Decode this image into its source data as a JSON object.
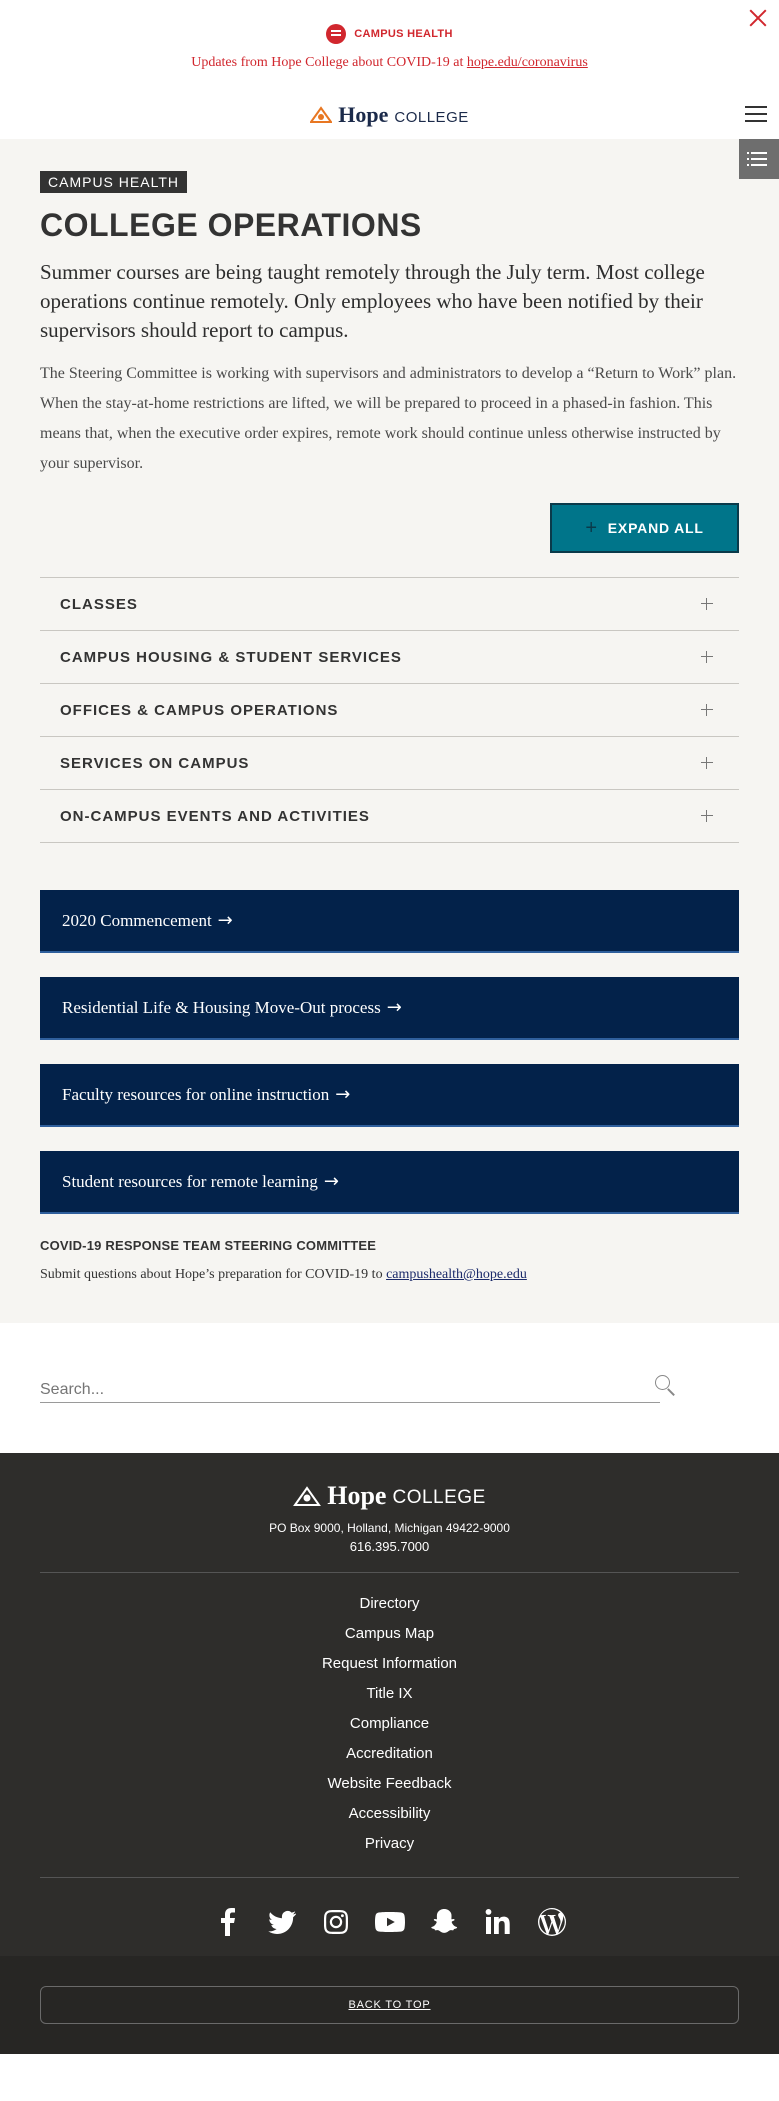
{
  "alert": {
    "tag": "CAMPUS HEALTH",
    "message_prefix": "Updates from Hope College about COVID-19 at ",
    "message_link": "hope.edu/coronavirus"
  },
  "header": {
    "logo_hope": "Hope",
    "logo_college": "COLLEGE"
  },
  "main": {
    "badge": "CAMPUS HEALTH",
    "title": "COLLEGE OPERATIONS",
    "lead": "Summer courses are being taught remotely through the July term. Most college operations continue remotely. Only employees who have been notified by their supervisors should report to campus.",
    "body": "The Steering Committee is working with supervisors and administrators to develop a “Return to Work” plan. When the stay-at-home restrictions are lifted, we will be prepared to proceed in a phased-in fashion. This means that, when the executive order expires, remote work should continue unless otherwise instructed by your supervisor.",
    "expand_all": "EXPAND ALL",
    "accordion": [
      {
        "label": "CLASSES"
      },
      {
        "label": "CAMPUS HOUSING & STUDENT SERVICES"
      },
      {
        "label": "OFFICES & CAMPUS OPERATIONS"
      },
      {
        "label": "SERVICES ON CAMPUS"
      },
      {
        "label": "ON-CAMPUS EVENTS AND ACTIVITIES"
      }
    ],
    "ctas": [
      {
        "label": "2020 Commencement"
      },
      {
        "label": "Residential Life & Housing Move-Out process"
      },
      {
        "label": "Faculty resources for online instruction"
      },
      {
        "label": "Student resources for remote learning"
      }
    ],
    "committee_title": "COVID-19 RESPONSE TEAM STEERING COMMITTEE",
    "committee_text": "Submit questions about Hope’s preparation for COVID-19 to ",
    "committee_email": "campushealth@hope.edu"
  },
  "search": {
    "placeholder": "Search..."
  },
  "footer": {
    "logo_hope": "Hope",
    "logo_college": "COLLEGE",
    "address": "PO Box 9000, Holland, Michigan 49422-9000",
    "phone": "616.395.7000",
    "links": [
      "Directory",
      "Campus Map",
      "Request Information",
      "Title IX",
      "Compliance",
      "Accreditation",
      "Website Feedback",
      "Accessibility",
      "Privacy"
    ],
    "social": [
      "facebook-icon",
      "twitter-icon",
      "instagram-icon",
      "youtube-icon",
      "snapchat-icon",
      "linkedin-icon",
      "wordpress-icon"
    ],
    "back_to_top": "BACK TO TOP"
  },
  "colors": {
    "alert_red": "#d1272e",
    "navy": "#03224a",
    "teal": "#00758a",
    "footer_bg": "#2e2d2b"
  }
}
